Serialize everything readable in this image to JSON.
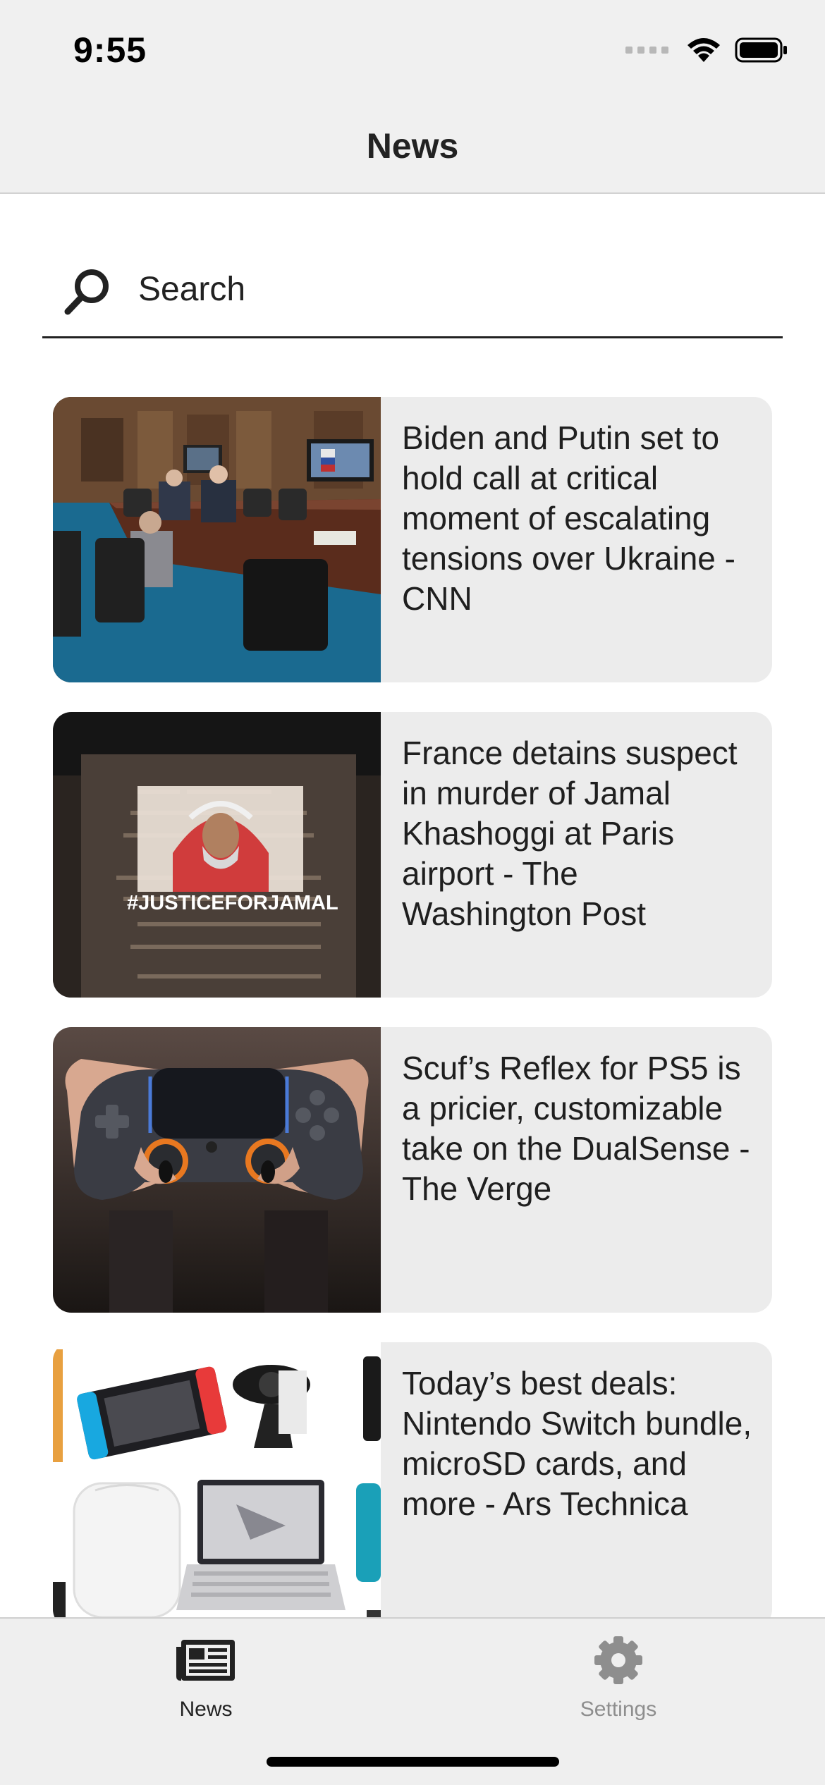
{
  "status_bar": {
    "time": "9:55"
  },
  "nav": {
    "title": "News"
  },
  "search": {
    "placeholder": "Search",
    "value": "",
    "icon": "search-icon"
  },
  "articles": [
    {
      "title": "Biden and Putin set to hold call at critical moment of escalating tensions over Ukraine - CNN",
      "image": "conference-room-video-call"
    },
    {
      "title": "France detains suspect in murder of Jamal Khashoggi at Paris airport - The Washington Post",
      "image": "projection-on-wall",
      "image_text": "#JUSTICEFORJAMAL"
    },
    {
      "title": "Scuf’s Reflex for PS5 is a pricier, customizable take on the DualSense - The Verge",
      "image": "hands-holding-controller"
    },
    {
      "title": "Today’s best deals: Nintendo Switch bundle, microSD cards, and more - Ars Technica",
      "image": "deals-product-collage"
    }
  ],
  "tabbar": {
    "tabs": [
      {
        "label": "News",
        "icon": "newspaper-icon",
        "active": true
      },
      {
        "label": "Settings",
        "icon": "gear-icon",
        "active": false
      }
    ]
  },
  "colors": {
    "bar_background": "#f0f0f0",
    "card_background": "#ececec",
    "active_tab": "#222222",
    "inactive_tab": "#8e8e8e"
  }
}
